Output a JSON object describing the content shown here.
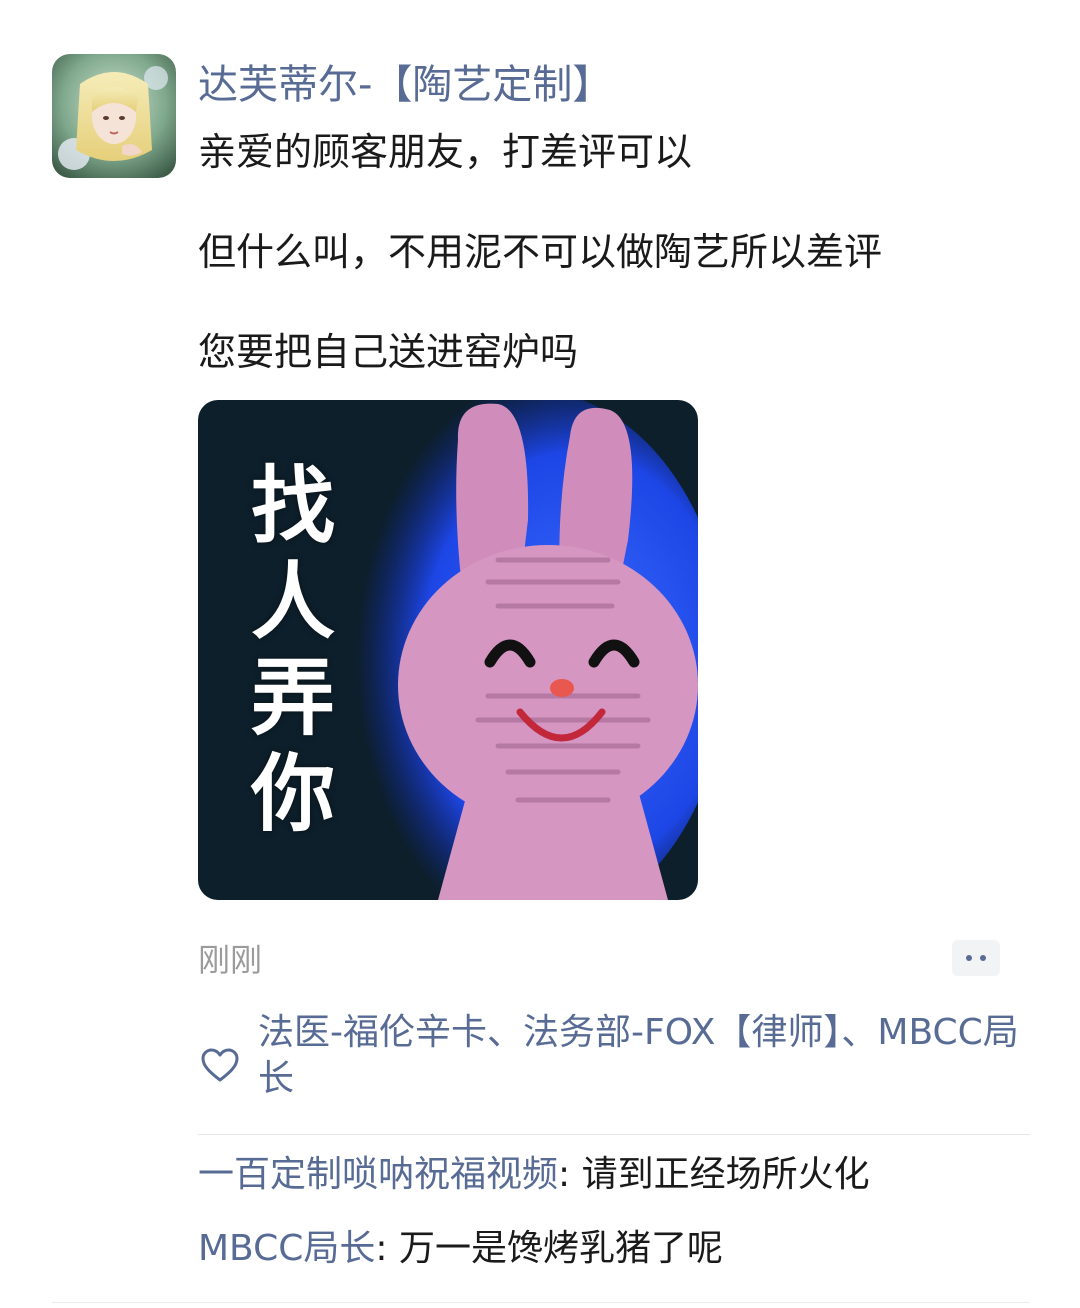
{
  "post": {
    "author": "达芙蒂尔-【陶艺定制】",
    "lines": [
      "亲爱的顾客朋友，打差评可以",
      "但什么叫，不用泥不可以做陶艺所以差评",
      "您要把自己送进窑炉吗"
    ],
    "sticker": {
      "caption_chars": [
        "找",
        "人",
        "弄",
        "你"
      ]
    },
    "timestamp": "刚刚"
  },
  "interactions": {
    "likes": "法医-福伦辛卡、法务部-FOX【律师】、MBCC局长",
    "comments": [
      {
        "author": "一百定制唢呐祝福视频",
        "separator": ": ",
        "text": "请到正经场所火化"
      },
      {
        "author": "MBCC局长",
        "separator": ": ",
        "text": "万一是馋烤乳猪了呢"
      }
    ]
  },
  "icons": {
    "like": "heart-outline-icon",
    "more": "more-dots-icon"
  },
  "colors": {
    "name_link": "#576b95",
    "text": "#1a1a1a",
    "timestamp": "#9b9b9b",
    "more_button_bg": "#f2f3f5"
  }
}
